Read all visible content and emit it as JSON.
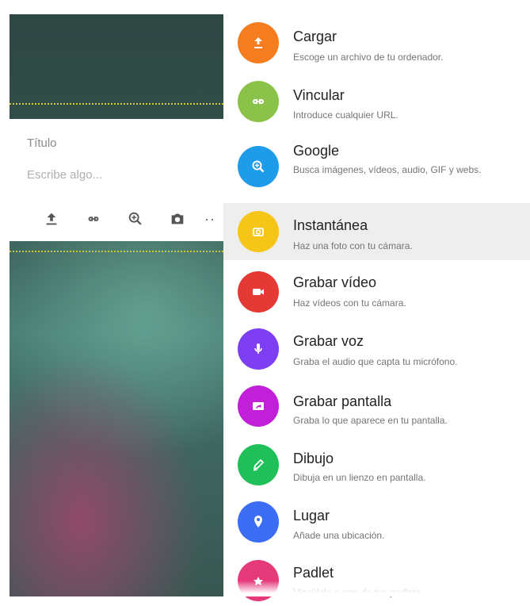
{
  "card": {
    "title_placeholder": "Título",
    "body_placeholder": "Escribe algo...",
    "more_label": "··"
  },
  "menu": {
    "items": [
      {
        "label": "Cargar",
        "desc": "Escoge un archivo de tu ordenador.",
        "color": "#f57c1f",
        "icon": "upload-icon"
      },
      {
        "label": "Vincular",
        "desc": "Introduce cualquier URL.",
        "color": "#8bc34a",
        "icon": "link-icon"
      },
      {
        "label": "Google",
        "desc": "Busca imágenes, vídeos, audio, GIF y webs.",
        "color": "#1e9be9",
        "icon": "search-zoom-icon"
      },
      {
        "label": "Instantánea",
        "desc": "Haz una foto con tu cámara.",
        "color": "#f5c518",
        "icon": "camera-icon"
      },
      {
        "label": "Grabar vídeo",
        "desc": "Haz vídeos con tu cámara.",
        "color": "#e53935",
        "icon": "video-camera-icon"
      },
      {
        "label": "Grabar voz",
        "desc": "Graba el audio que capta tu micrófono.",
        "color": "#7e3ff2",
        "icon": "microphone-icon"
      },
      {
        "label": "Grabar pantalla",
        "desc": "Graba lo que aparece en tu pantalla.",
        "color": "#c21fd8",
        "icon": "screen-record-icon"
      },
      {
        "label": "Dibujo",
        "desc": "Dibuja en un lienzo en pantalla.",
        "color": "#1fbf5a",
        "icon": "draw-icon"
      },
      {
        "label": "Lugar",
        "desc": "Añade una ubicación.",
        "color": "#3a6cf4",
        "icon": "location-pin-icon"
      },
      {
        "label": "Padlet",
        "desc": "Vincúlalo a otro de tus padlets.",
        "color": "#e53a7a",
        "icon": "padlet-icon"
      }
    ]
  }
}
